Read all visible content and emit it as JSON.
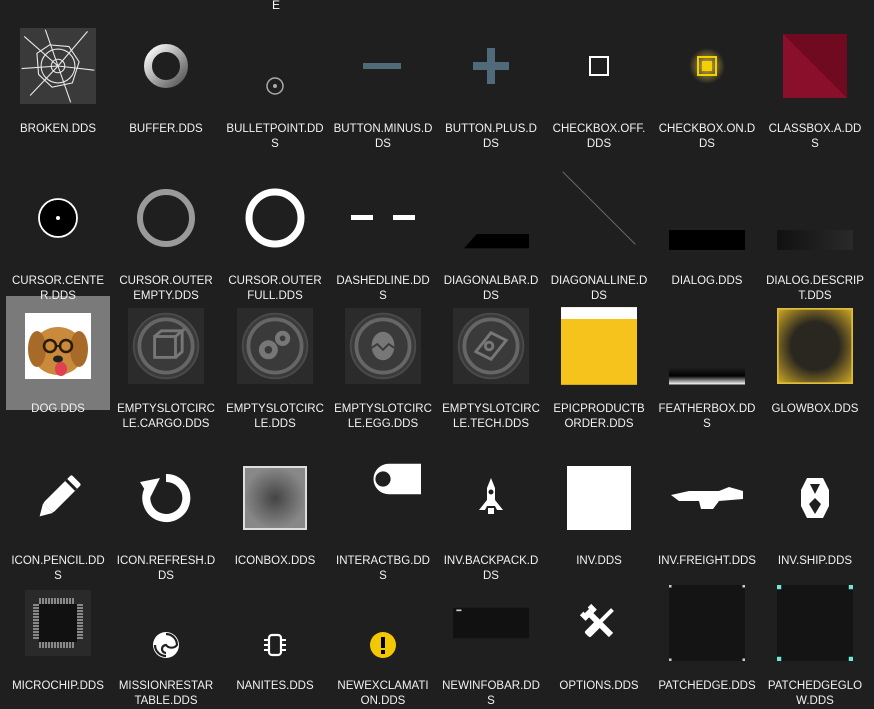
{
  "header": {
    "partial_char": "E"
  },
  "files": [
    {
      "label": "BROKEN.DDS",
      "icon": "broken-glass-icon"
    },
    {
      "label": "BUFFER.DDS",
      "icon": "ring-gradient-icon"
    },
    {
      "label": "BULLETPOINT.DDS",
      "icon": "bullet-point-icon"
    },
    {
      "label": "BUTTON.MINUS.DDS",
      "icon": "minus-icon"
    },
    {
      "label": "BUTTON.PLUS.DDS",
      "icon": "plus-icon"
    },
    {
      "label": "CHECKBOX.OFF.DDS",
      "icon": "checkbox-off-icon"
    },
    {
      "label": "CHECKBOX.ON.DDS",
      "icon": "checkbox-on-icon"
    },
    {
      "label": "CLASSBOX.A.DDS",
      "icon": "classbox-icon"
    },
    {
      "label": "CURSOR.CENTER.DDS",
      "icon": "cursor-center-icon"
    },
    {
      "label": "CURSOR.OUTEREMPTY.DDS",
      "icon": "cursor-outer-empty-icon"
    },
    {
      "label": "CURSOR.OUTERFULL.DDS",
      "icon": "cursor-outer-full-icon"
    },
    {
      "label": "DASHEDLINE.DDS",
      "icon": "dashed-line-icon"
    },
    {
      "label": "DIAGONALBAR.DDS",
      "icon": "diagonal-bar-icon"
    },
    {
      "label": "DIAGONALLINE.DDS",
      "icon": "diagonal-line-icon"
    },
    {
      "label": "DIALOG.DDS",
      "icon": "dialog-bar-icon"
    },
    {
      "label": "DIALOG.DESCRIPT.DDS",
      "icon": "dialog-description-icon"
    },
    {
      "label": "DOG.DDS",
      "icon": "dog-photo-icon"
    },
    {
      "label": "EMPTYSLOTCIRCLE.CARGO.DDS",
      "icon": "cargo-slot-icon"
    },
    {
      "label": "EMPTYSLOTCIRCLE.DDS",
      "icon": "gear-slot-icon"
    },
    {
      "label": "EMPTYSLOTCIRCLE.EGG.DDS",
      "icon": "egg-slot-icon"
    },
    {
      "label": "EMPTYSLOTCIRCLE.TECH.DDS",
      "icon": "tech-slot-icon"
    },
    {
      "label": "EPICPRODUCTBORDER.DDS",
      "icon": "epic-border-icon"
    },
    {
      "label": "FEATHERBOX.DDS",
      "icon": "featherbox-icon"
    },
    {
      "label": "GLOWBOX.DDS",
      "icon": "glowbox-icon"
    },
    {
      "label": "ICON.PENCIL.DDS",
      "icon": "pencil-icon"
    },
    {
      "label": "ICON.REFRESH.DDS",
      "icon": "refresh-icon"
    },
    {
      "label": "ICONBOX.DDS",
      "icon": "iconbox-icon"
    },
    {
      "label": "INTERACTBG.DDS",
      "icon": "interact-bg-icon"
    },
    {
      "label": "INV.BACKPACK.DDS",
      "icon": "backpack-icon"
    },
    {
      "label": "INV.DDS",
      "icon": "inventory-square-icon"
    },
    {
      "label": "INV.FREIGHT.DDS",
      "icon": "freight-ship-icon"
    },
    {
      "label": "INV.SHIP.DDS",
      "icon": "ship-icon"
    },
    {
      "label": "MICROCHIP.DDS",
      "icon": "microchip-icon"
    },
    {
      "label": "MISSIONRESTARTABLE.DDS",
      "icon": "swirl-icon"
    },
    {
      "label": "NANITES.DDS",
      "icon": "nanites-icon"
    },
    {
      "label": "NEWEXCLAMATION.DDS",
      "icon": "exclamation-icon"
    },
    {
      "label": "NEWINFOBAR.DDS",
      "icon": "info-bar-icon"
    },
    {
      "label": "OPTIONS.DDS",
      "icon": "wrench-screwdriver-icon"
    },
    {
      "label": "PATCHEDGE.DDS",
      "icon": "patch-edge-icon"
    },
    {
      "label": "PATCHEDGEGLOW.DDS",
      "icon": "patch-edge-glow-icon"
    }
  ],
  "selected_label": "DOG.DDS",
  "colors": {
    "background": "#1f1f1f",
    "selection": "#7a7a7a",
    "epic_yellow": "#f6c21c",
    "classbox_red": "#8a0f2a",
    "exclamation_yellow": "#f3c800"
  }
}
